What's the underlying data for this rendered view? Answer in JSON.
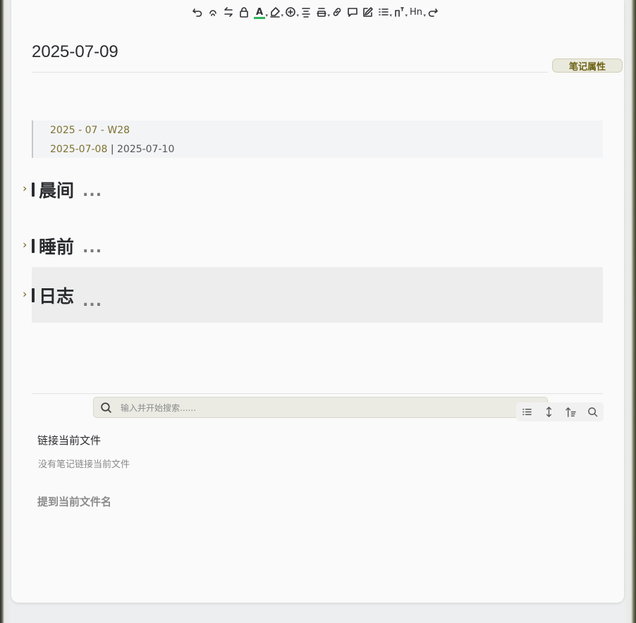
{
  "note": {
    "title": "2025-07-09",
    "properties_label": "笔记属性"
  },
  "toolbar": {
    "items": [
      {
        "icon": "undo-icon"
      },
      {
        "icon": "link-cycle-icon"
      },
      {
        "icon": "swap-icon"
      },
      {
        "icon": "lock-icon"
      },
      {
        "icon": "text-color-icon",
        "label": "A",
        "accent": "#2fb35a"
      },
      {
        "icon": "highlighter-icon"
      },
      {
        "icon": "add-circle-icon"
      },
      {
        "icon": "align-icon"
      },
      {
        "icon": "strikethrough-box-icon"
      },
      {
        "icon": "link-icon"
      },
      {
        "icon": "comment-icon"
      },
      {
        "icon": "edit-icon"
      },
      {
        "icon": "list-icon"
      },
      {
        "icon": "superscript-icon"
      },
      {
        "icon": "heading-icon",
        "label": "Hn"
      },
      {
        "icon": "redo-icon"
      }
    ]
  },
  "nav_block": {
    "week": "2025 - 07 - W28",
    "prev_day": "2025-07-08",
    "separator": " | ",
    "next_day": "2025-07-10"
  },
  "headings": [
    {
      "text": "晨间",
      "collapsed_indicator": "..."
    },
    {
      "text": "睡前",
      "collapsed_indicator": "..."
    },
    {
      "text": "日志",
      "collapsed_indicator": "..."
    }
  ],
  "backlinks": {
    "search_placeholder": "输入并开始搜索......",
    "search_value": "",
    "linked_title": "链接当前文件",
    "linked_empty": "没有笔记链接当前文件",
    "mentions_title": "提到当前文件名"
  },
  "colors": {
    "accent": "#7d7230",
    "panel_bg": "#fafafa",
    "highlight_row": "#ededed",
    "color_bar": "#2fb35a"
  }
}
